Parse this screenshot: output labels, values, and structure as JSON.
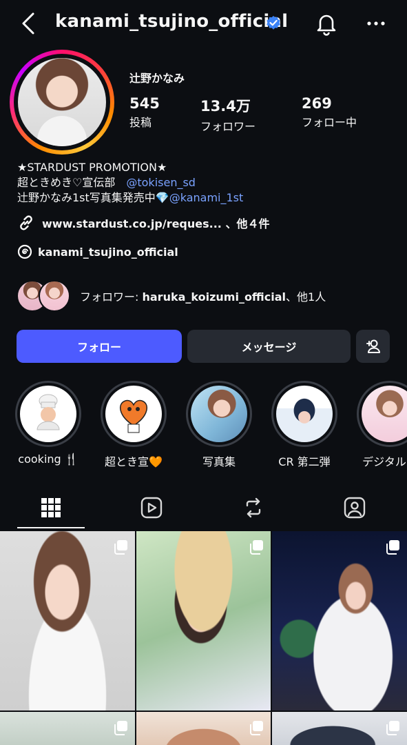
{
  "header": {
    "username": "kanami_tsujino_official",
    "icons": [
      "back-arrow-icon",
      "verified-badge-icon",
      "bell-icon",
      "more-icon"
    ]
  },
  "profile": {
    "display_name": "辻野かなみ",
    "stats": [
      {
        "value": "545",
        "label": "投稿"
      },
      {
        "value": "13.4万",
        "label": "フォロワー"
      },
      {
        "value": "269",
        "label": "フォロー中"
      }
    ],
    "bio": {
      "line1": "★STARDUST PROMOTION★",
      "line2_text": "超ときめき♡宣伝部　",
      "line2_mention": "@tokisen_sd",
      "line3_text": "辻野かなみ1st写真集発売中💎",
      "line3_mention": "@kanami_1st"
    },
    "link_text": "www.stardust.co.jp/reques... 、他４件",
    "threads_handle": "kanami_tsujino_official",
    "followed_by_prefix": "フォロワー: ",
    "followed_by_name": "haruka_koizumi_official",
    "followed_by_suffix": "、他1人"
  },
  "actions": {
    "follow": "フォロー",
    "message": "メッセージ",
    "add_user_icon": "add-user-icon"
  },
  "highlights": [
    {
      "label": "cooking 🍴"
    },
    {
      "label": "超とき宣🧡"
    },
    {
      "label": "写真集"
    },
    {
      "label": "CR 第二弾"
    },
    {
      "label": "デジタル写"
    }
  ],
  "tabs": [
    "grid-icon",
    "reels-icon",
    "reposts-icon",
    "tagged-icon"
  ],
  "colors": {
    "background": "#0c0e12",
    "accent": "#4d5bff",
    "mention": "#7aa2ff",
    "verified": "#3b82f6"
  }
}
